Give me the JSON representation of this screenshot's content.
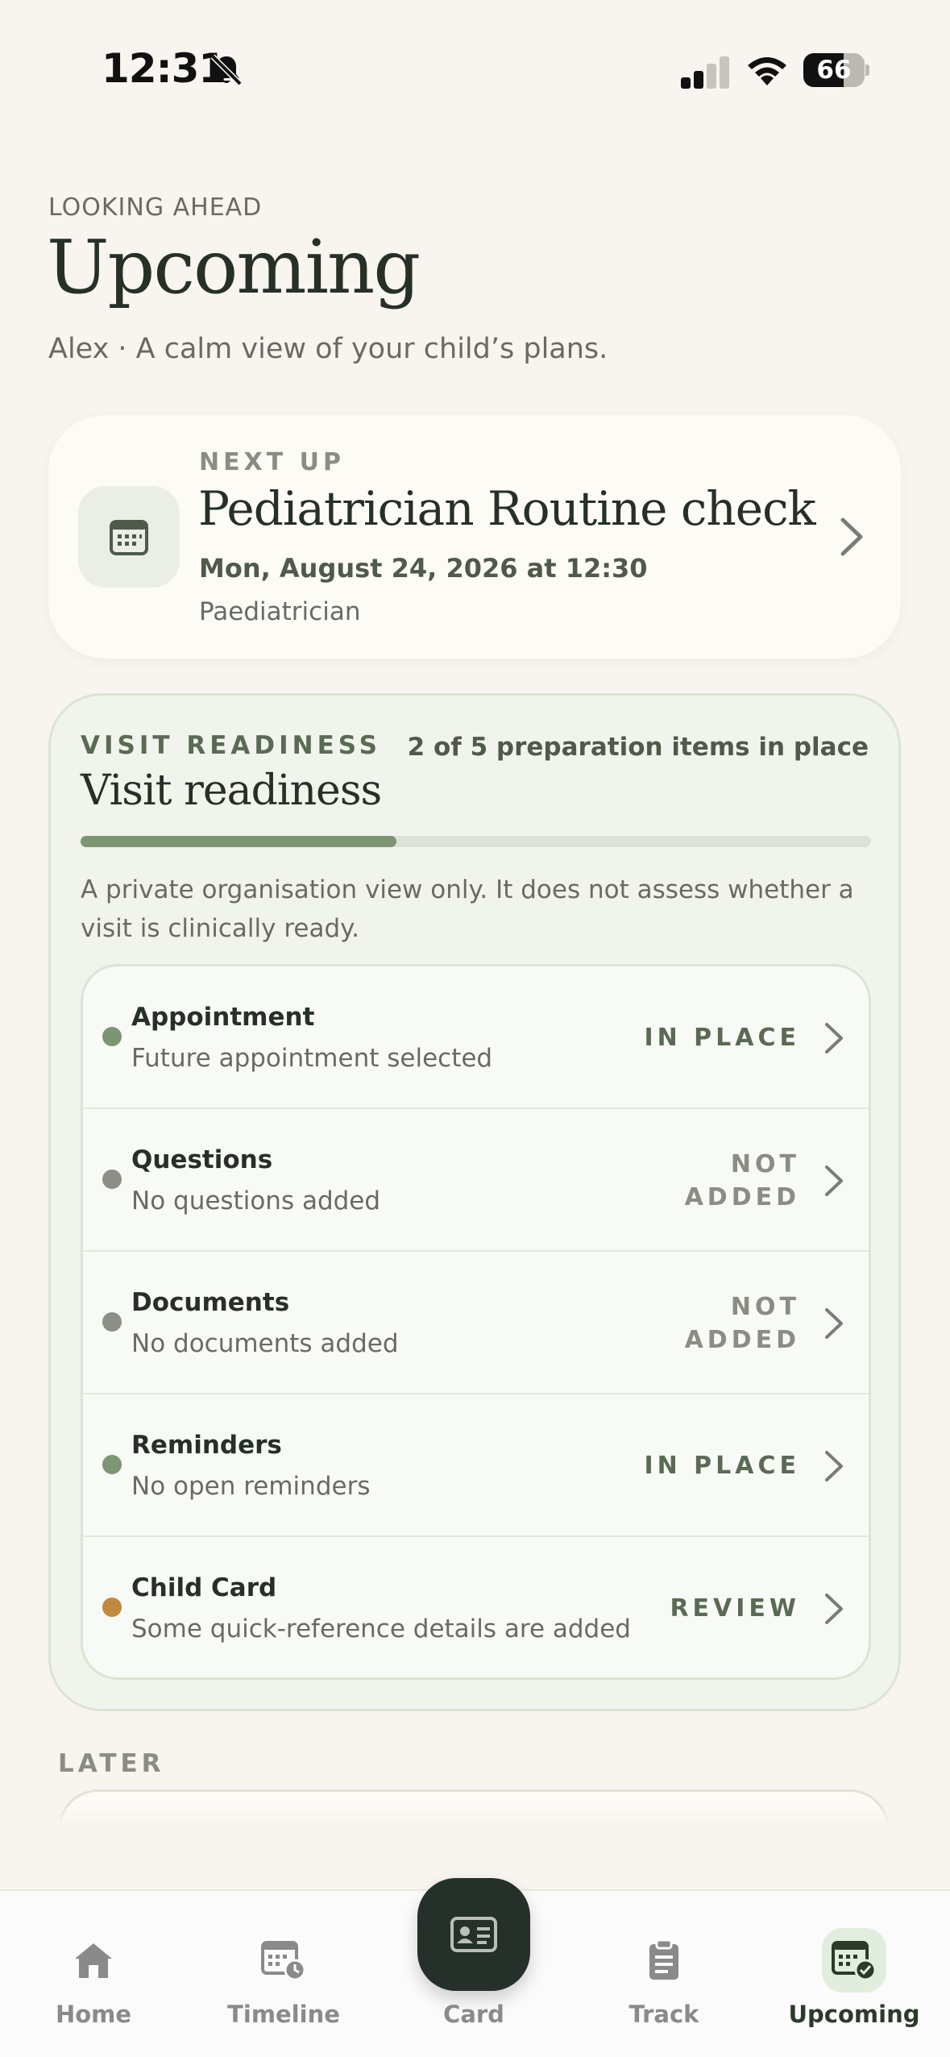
{
  "status_bar": {
    "time": "12:31",
    "battery": "66",
    "battery_level": 0.66
  },
  "header": {
    "eyebrow": "LOOKING AHEAD",
    "title": "Upcoming",
    "subtitle": "Alex · A calm view of your child’s plans."
  },
  "next_up": {
    "eyebrow": "NEXT UP",
    "title": "Pediatrician Routine check",
    "datetime": "Mon, August 24, 2026 at 12:30",
    "provider": "Paediatrician"
  },
  "readiness": {
    "eyebrow": "VISIT READINESS",
    "title": "Visit readiness",
    "count_text": "2 of 5 preparation items in place",
    "progress": 0.4,
    "note": "A private organisation view only. It does not assess whether a visit is clinically ready.",
    "items": [
      {
        "label": "Appointment",
        "desc": "Future appointment selected",
        "status": "IN PLACE",
        "dot_color": "#7d9573",
        "status_color": "#5b6a55"
      },
      {
        "label": "Questions",
        "desc": "No questions added",
        "status": "NOT ADDED",
        "dot_color": "#8b8f86",
        "status_color": "#8a8d84"
      },
      {
        "label": "Documents",
        "desc": "No documents added",
        "status": "NOT ADDED",
        "dot_color": "#8b8f86",
        "status_color": "#8a8d84"
      },
      {
        "label": "Reminders",
        "desc": "No open reminders",
        "status": "IN PLACE",
        "dot_color": "#7d9573",
        "status_color": "#5b6a55"
      },
      {
        "label": "Child Card",
        "desc": "Some quick-reference details are added",
        "status": "REVIEW",
        "dot_color": "#c08a3e",
        "status_color": "#5b6a55"
      }
    ]
  },
  "later": {
    "heading": "LATER"
  },
  "tabbar": {
    "home": "Home",
    "timeline": "Timeline",
    "card": "Card",
    "track": "Track",
    "upcoming": "Upcoming"
  },
  "colors": {
    "accent": "#7d9573",
    "dark": "#25302a",
    "background": "#f8f4ef"
  }
}
